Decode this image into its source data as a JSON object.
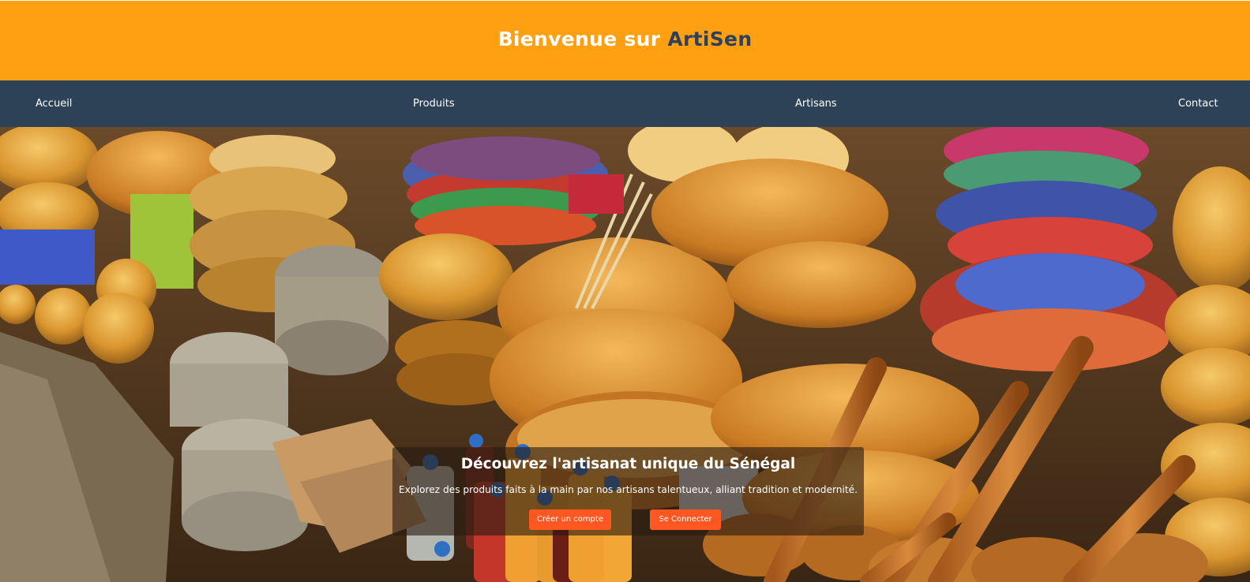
{
  "header": {
    "title_prefix": "Bienvenue sur ",
    "brand": "ArtiSen",
    "background": "#ff9f12",
    "brand_color": "#2e4158"
  },
  "nav": {
    "background": "#2d4257",
    "items": [
      {
        "label": "Accueil"
      },
      {
        "label": "Produits"
      },
      {
        "label": "Artisans"
      },
      {
        "label": "Contact"
      }
    ]
  },
  "hero": {
    "image_description_icon": "market-photo",
    "title": "Découvrez l'artisanat unique du Sénégal",
    "subtitle": "Explorez des produits faits à la main par nos artisans talentueux, alliant tradition et modernité.",
    "buttons": {
      "create_account": "Créer un compte",
      "login": "Se Connecter"
    },
    "button_color": "#ff5722"
  }
}
